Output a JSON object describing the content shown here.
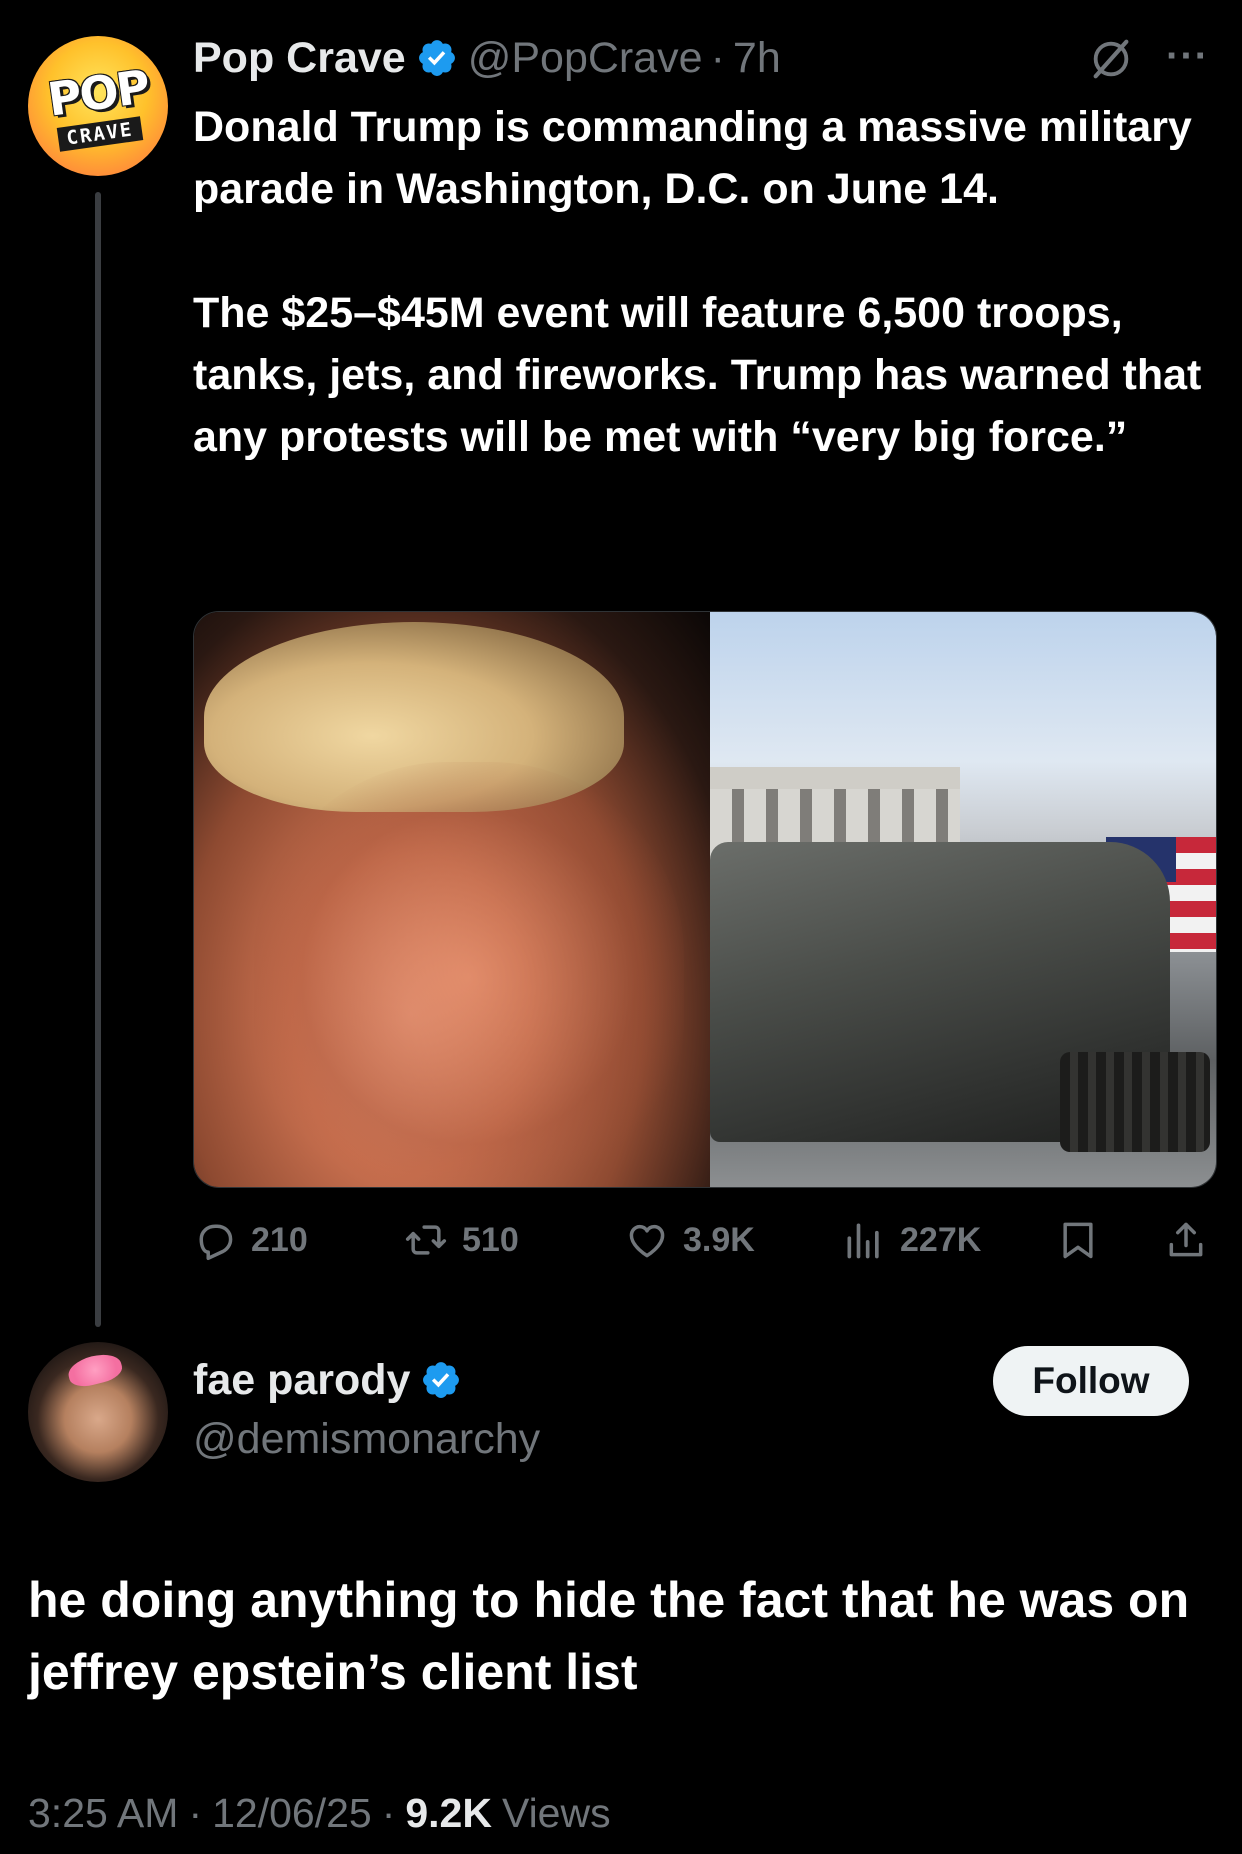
{
  "parent_tweet": {
    "avatar": {
      "line1": "POP",
      "line2": "CRAVE"
    },
    "author": "Pop Crave",
    "handle": "@PopCrave",
    "separator": "·",
    "time": "7h",
    "text": "Donald Trump is commanding a massive military parade in Washington, D.C. on June 14.\n\nThe $25–$45M event will feature 6,500 troops, tanks, jets, and fireworks. Trump has warned that any protests will be met with “very big force.”",
    "actions": {
      "replies": "210",
      "reposts": "510",
      "likes": "3.9K",
      "views": "227K"
    },
    "icons": [
      "verified-badge-icon",
      "grok-icon",
      "more-icon",
      "reply-icon",
      "repost-icon",
      "like-icon",
      "views-icon",
      "bookmark-icon",
      "share-icon"
    ]
  },
  "reply_tweet": {
    "author": "fae parody",
    "handle": "@demismonarchy",
    "follow_label": "Follow",
    "text": "he doing anything to hide the fact that he was on jeffrey epstein’s client list",
    "timestamp": "3:25 AM",
    "date": "12/06/25",
    "separator": "·",
    "views_count": "9.2K",
    "views_label": "Views"
  },
  "colors": {
    "background": "#000000",
    "text_primary": "#e7e9ea",
    "text_secondary": "#71767b",
    "verified_blue": "#1d9bf0",
    "follow_bg": "#eff3f4"
  }
}
